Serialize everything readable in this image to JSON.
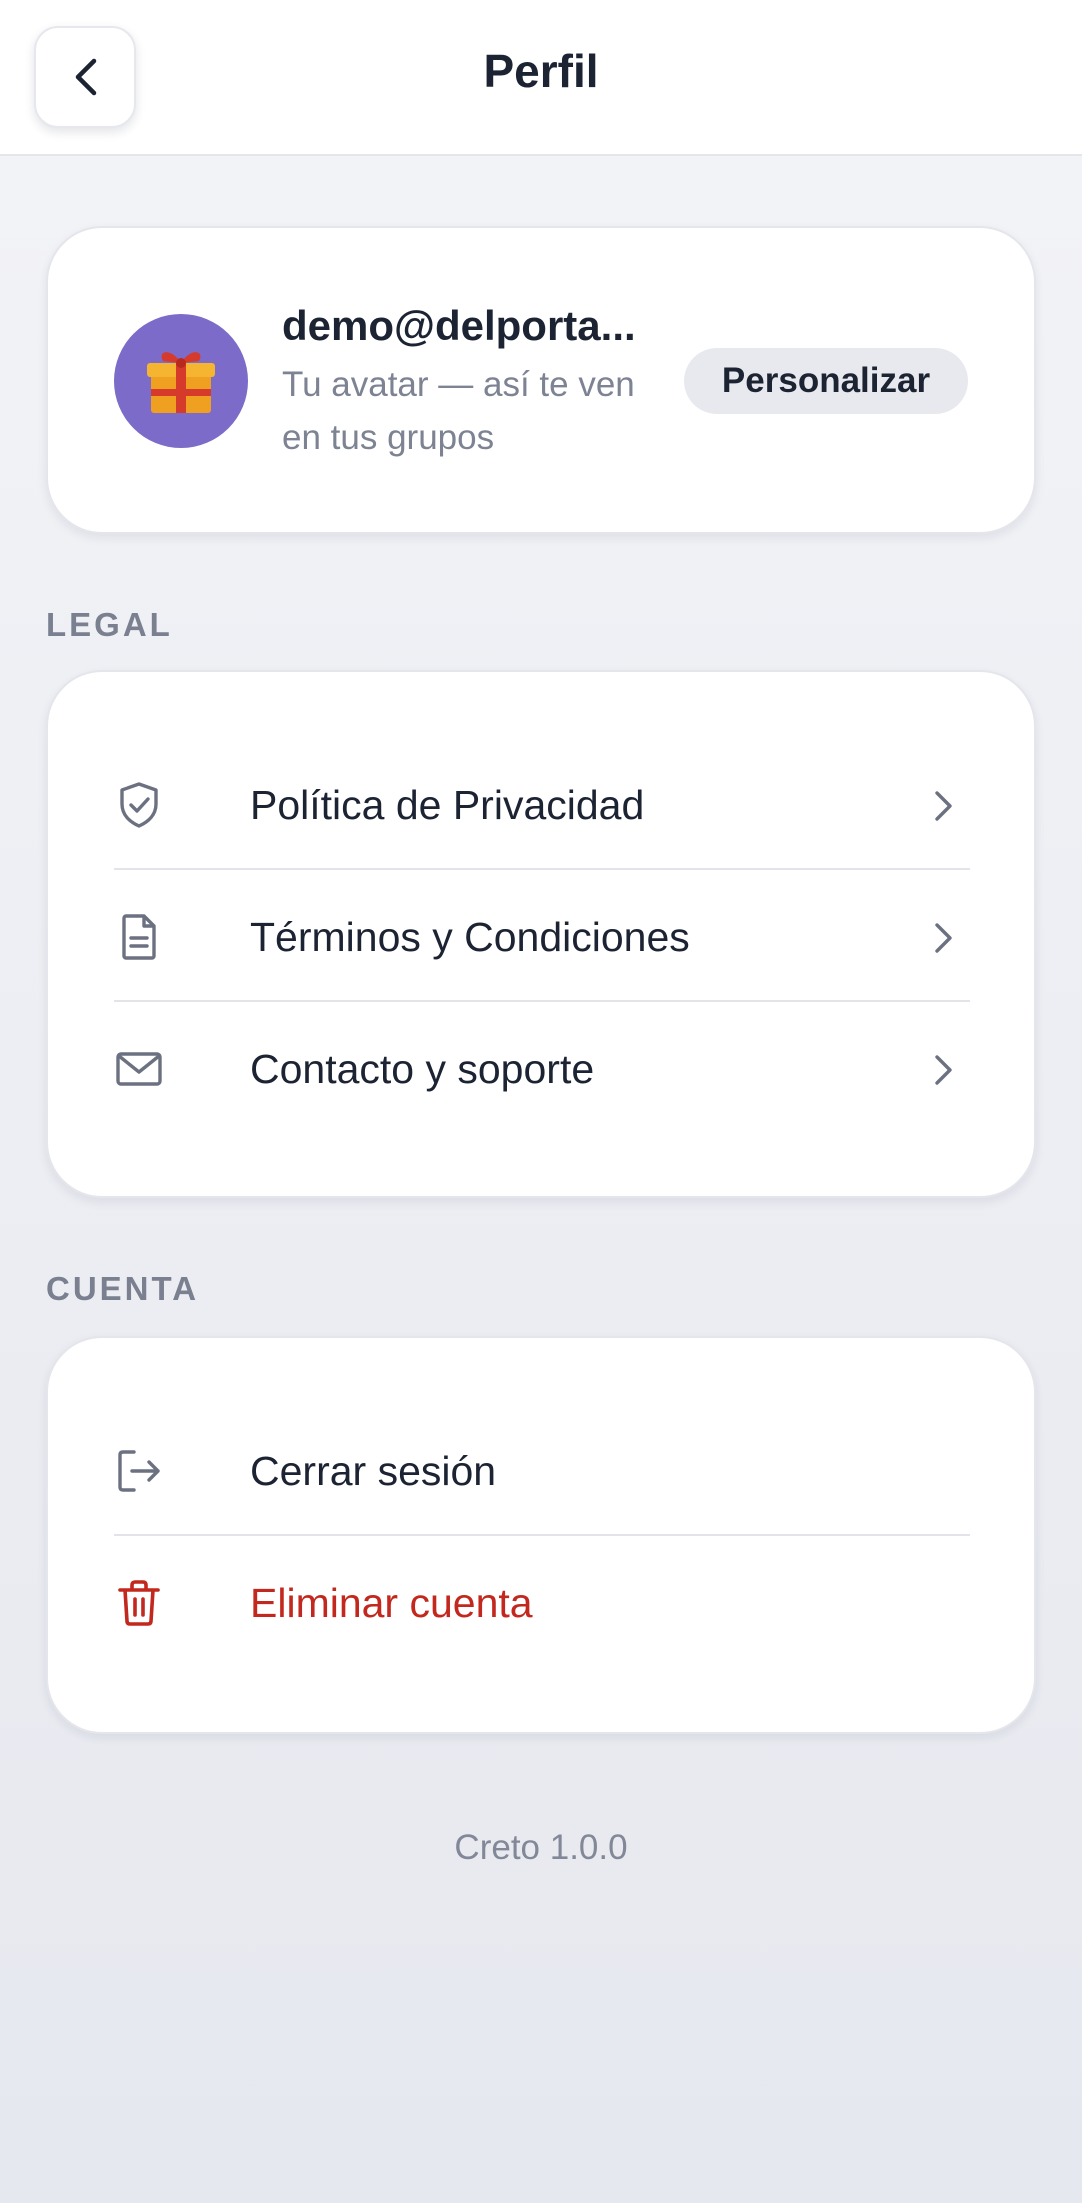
{
  "header": {
    "title": "Perfil",
    "back_icon": "chevron-left-icon"
  },
  "profile": {
    "email": "demo@delporta...",
    "avatar_description": "Tu avatar — así te ven en tus grupos",
    "customize_label": "Personalizar",
    "avatar_icon": "gift-icon",
    "avatar_color": "#7c6bc8"
  },
  "legal": {
    "section_title": "LEGAL",
    "items": [
      {
        "label": "Política de Privacidad",
        "icon": "shield-check-icon"
      },
      {
        "label": "Términos y Condiciones",
        "icon": "document-icon"
      },
      {
        "label": "Contacto y soporte",
        "icon": "mail-icon"
      }
    ]
  },
  "account": {
    "section_title": "CUENTA",
    "items": [
      {
        "label": "Cerrar sesión",
        "icon": "logout-icon"
      },
      {
        "label": "Eliminar cuenta",
        "icon": "trash-icon",
        "color": "#c2281d"
      }
    ]
  },
  "footer": {
    "version": "Creto 1.0.0"
  }
}
